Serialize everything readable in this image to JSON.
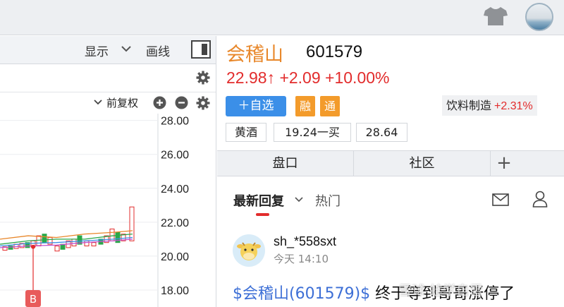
{
  "topbar": {
    "skin_icon": "tshirt-icon",
    "avatar_icon": "avatar"
  },
  "chart_toolbar": {
    "display_label": "显示",
    "draw_label": "画线"
  },
  "chart_controls": {
    "adjust_label": "前复权"
  },
  "chart_data": {
    "type": "candlestick",
    "y_ticks": [
      "28.00",
      "26.00",
      "24.00",
      "22.00",
      "20.00",
      "18.00"
    ],
    "ylim": [
      17.5,
      28.4
    ],
    "marker_label": "B",
    "colors": {
      "up": "#e22c2c",
      "down": "#2aa84a",
      "ma1": "#e8872a",
      "ma2": "#2aa84a",
      "ma3": "#3b8fe8",
      "ma4": "#c04fd0"
    }
  },
  "stock": {
    "name": "会稽山",
    "code": "601579",
    "price_line": "22.98↑ +2.09 +10.00%",
    "add_watch_label": "＋自选",
    "badge_margin": "融",
    "badge_connect": "通",
    "industry_name": "饮料制造",
    "industry_change": "+2.31%",
    "tags": [
      "黄酒",
      "19.24一买",
      "28.64"
    ]
  },
  "tabs": {
    "handicap": "盘口",
    "community": "社区",
    "add": "+"
  },
  "feed": {
    "latest_label": "最新回复",
    "hot_label": "热门",
    "mail_icon": "mail-icon",
    "user_icon": "user-icon"
  },
  "post": {
    "username": "sh_*558sxt",
    "time": "今天 14:10",
    "link_text": "$会稽山(601579)$",
    "body": " 终于等到哥哥涨停了"
  },
  "watermark": {
    "text": "雪球 蛙学自雪"
  },
  "colors": {
    "accent": "#3b8fe8",
    "up": "#e22c2c",
    "brand": "#e8872a"
  }
}
